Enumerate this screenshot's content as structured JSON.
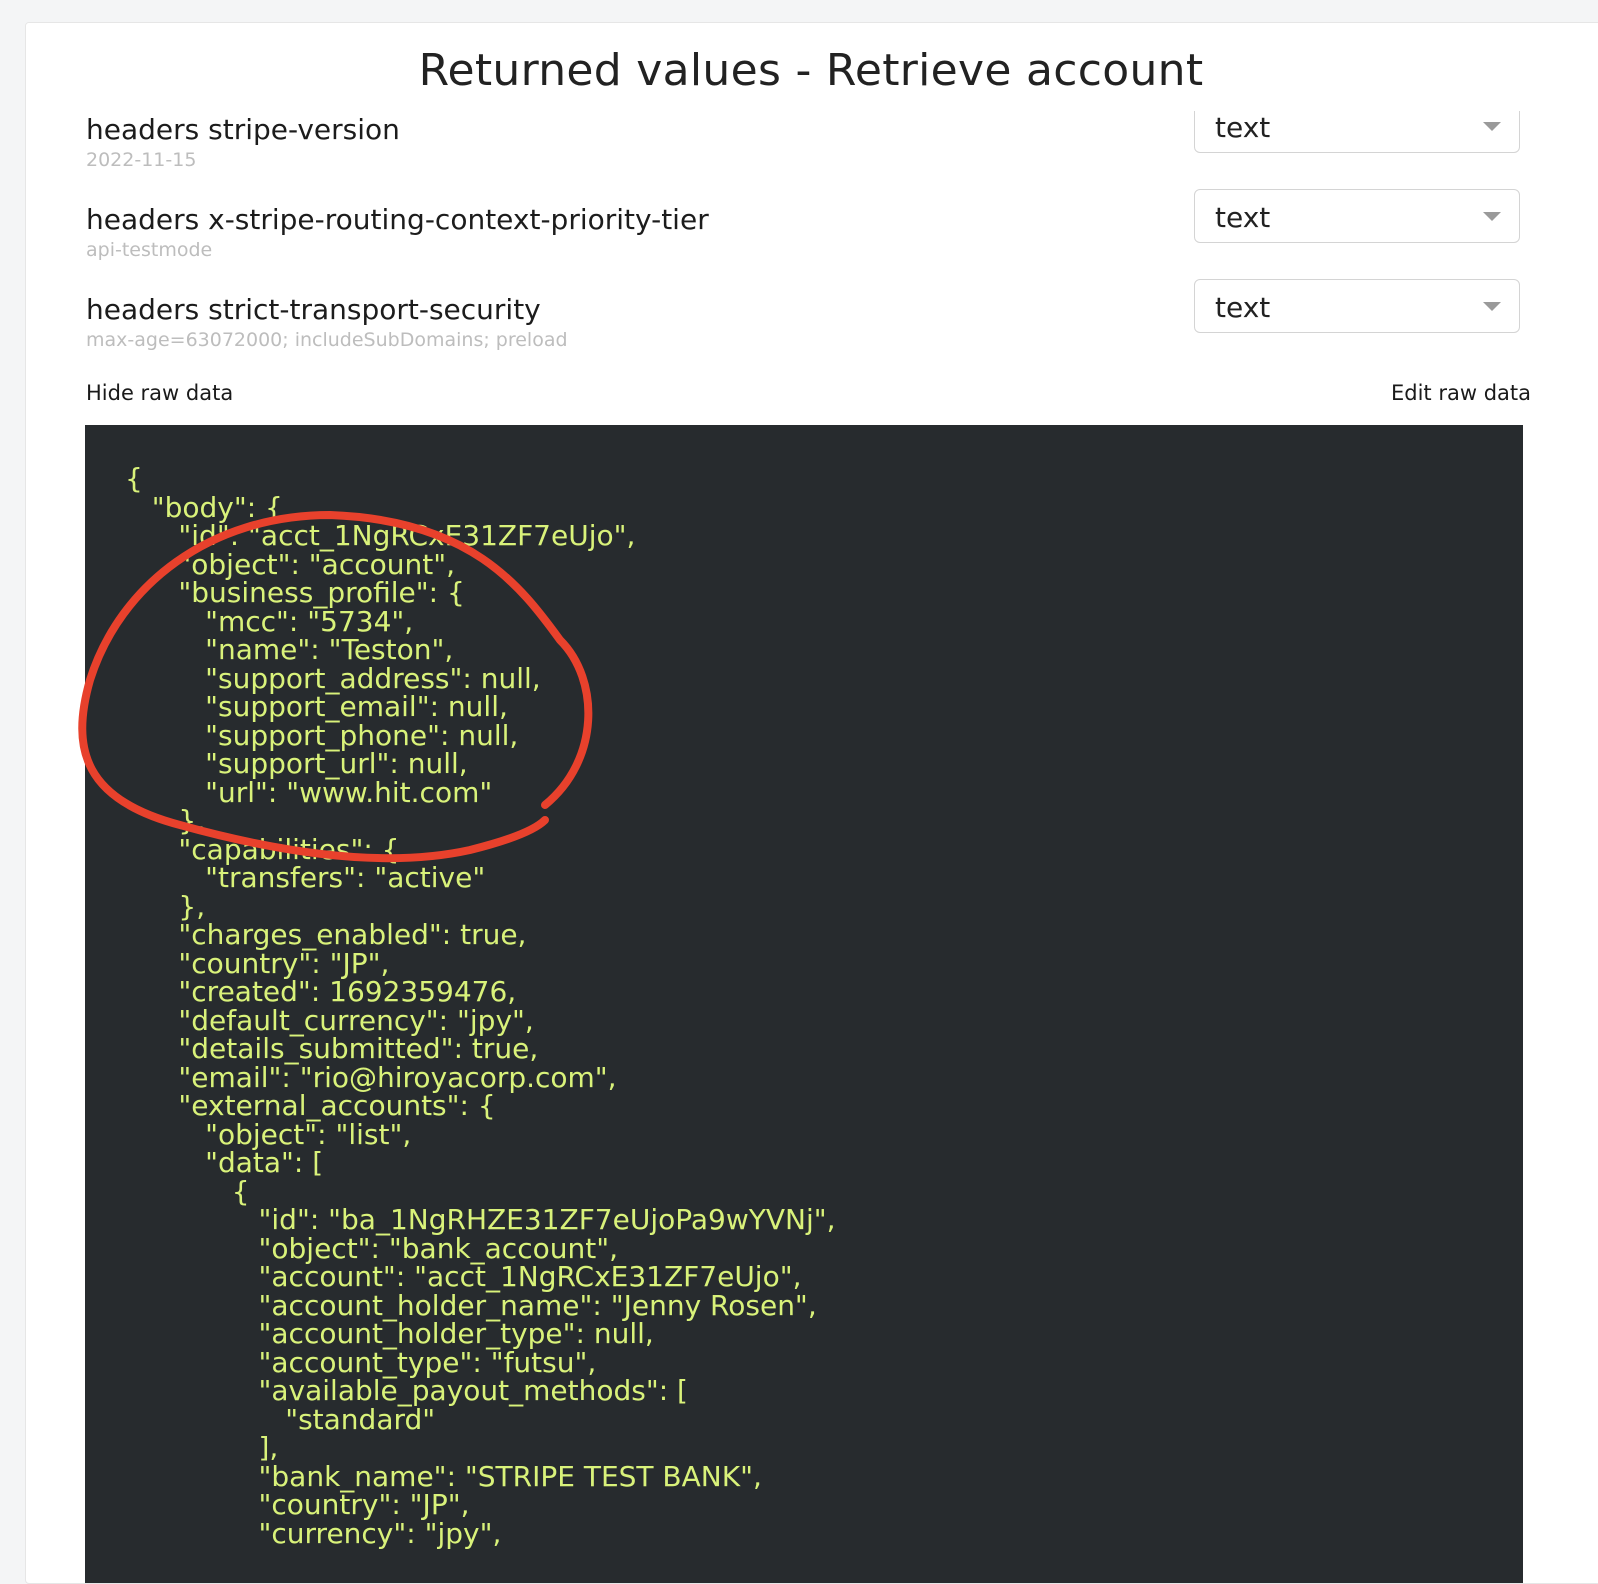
{
  "dialog": {
    "title": "Returned values - Retrieve account"
  },
  "fields": [
    {
      "name": "headers stripe-version",
      "value": "2022-11-15",
      "type": "text"
    },
    {
      "name": "headers x-stripe-routing-context-priority-tier",
      "value": "api-testmode",
      "type": "text"
    },
    {
      "name": "headers strict-transport-security",
      "value": "max-age=63072000; includeSubDomains; preload",
      "type": "text"
    }
  ],
  "raw": {
    "hide_label": "Hide raw data",
    "edit_label": "Edit raw data",
    "lines": [
      "{",
      "   \"body\": {",
      "      \"id\": \"acct_1NgRCxE31ZF7eUjo\",",
      "      \"object\": \"account\",",
      "      \"business_profile\": {",
      "         \"mcc\": \"5734\",",
      "         \"name\": \"Teston\",",
      "         \"support_address\": null,",
      "         \"support_email\": null,",
      "         \"support_phone\": null,",
      "         \"support_url\": null,",
      "         \"url\": \"www.hit.com\"",
      "      },",
      "      \"capabilities\": {",
      "         \"transfers\": \"active\"",
      "      },",
      "      \"charges_enabled\": true,",
      "      \"country\": \"JP\",",
      "      \"created\": 1692359476,",
      "      \"default_currency\": \"jpy\",",
      "      \"details_submitted\": true,",
      "      \"email\": \"rio@hiroyacorp.com\",",
      "      \"external_accounts\": {",
      "         \"object\": \"list\",",
      "         \"data\": [",
      "            {",
      "               \"id\": \"ba_1NgRHZE31ZF7eUjoPa9wYVNj\",",
      "               \"object\": \"bank_account\",",
      "               \"account\": \"acct_1NgRCxE31ZF7eUjo\",",
      "               \"account_holder_name\": \"Jenny Rosen\",",
      "               \"account_holder_type\": null,",
      "               \"account_type\": \"futsu\",",
      "               \"available_payout_methods\": [",
      "                  \"standard\"",
      "               ],",
      "               \"bank_name\": \"STRIPE TEST BANK\",",
      "               \"country\": \"JP\",",
      "               \"currency\": \"jpy\","
    ]
  },
  "colors": {
    "code_background": "#272b2e",
    "code_text": "#d9f27a",
    "annotation": "#e8412c"
  }
}
